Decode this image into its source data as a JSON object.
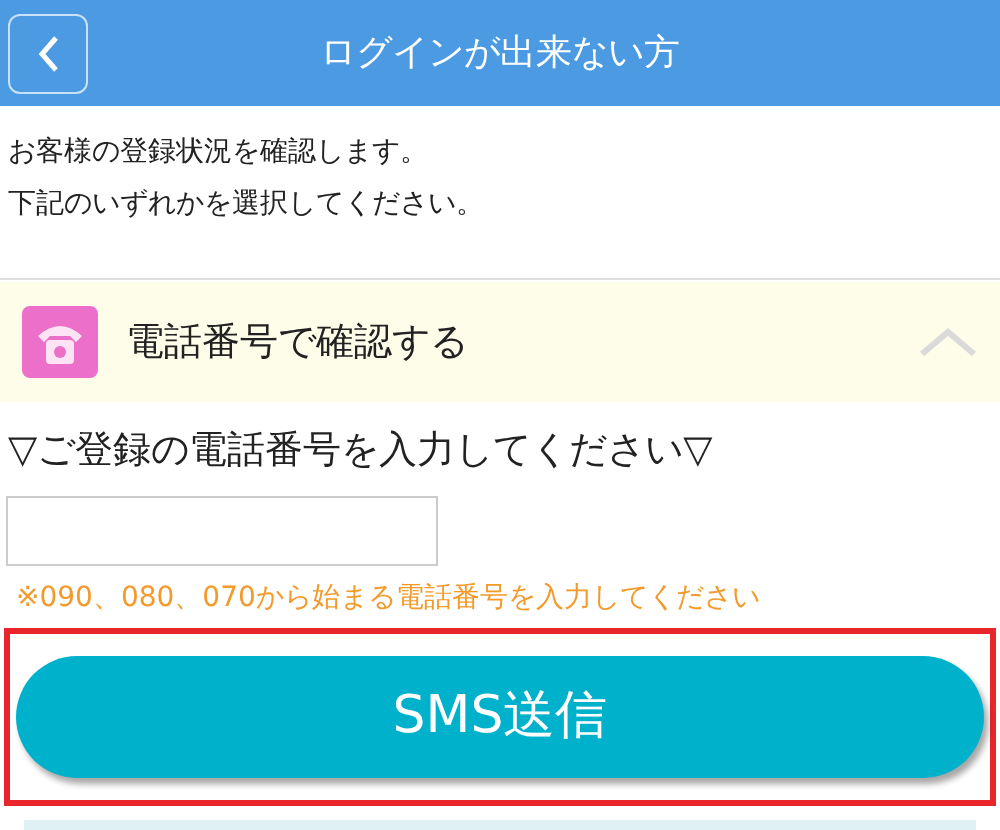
{
  "header": {
    "title": "ログインが出来ない方"
  },
  "intro": [
    "お客様の登録状況を確認します。",
    "下記のいずれかを選択してください。"
  ],
  "section": {
    "title": "電話番号で確認する",
    "expanded": true
  },
  "field_label": "▽ご登録の電話番号を入力してください▽",
  "note": "※090、080、070から始まる電話番号を入力してください",
  "submit": {
    "label": "SMS送信",
    "highlighted": true
  }
}
